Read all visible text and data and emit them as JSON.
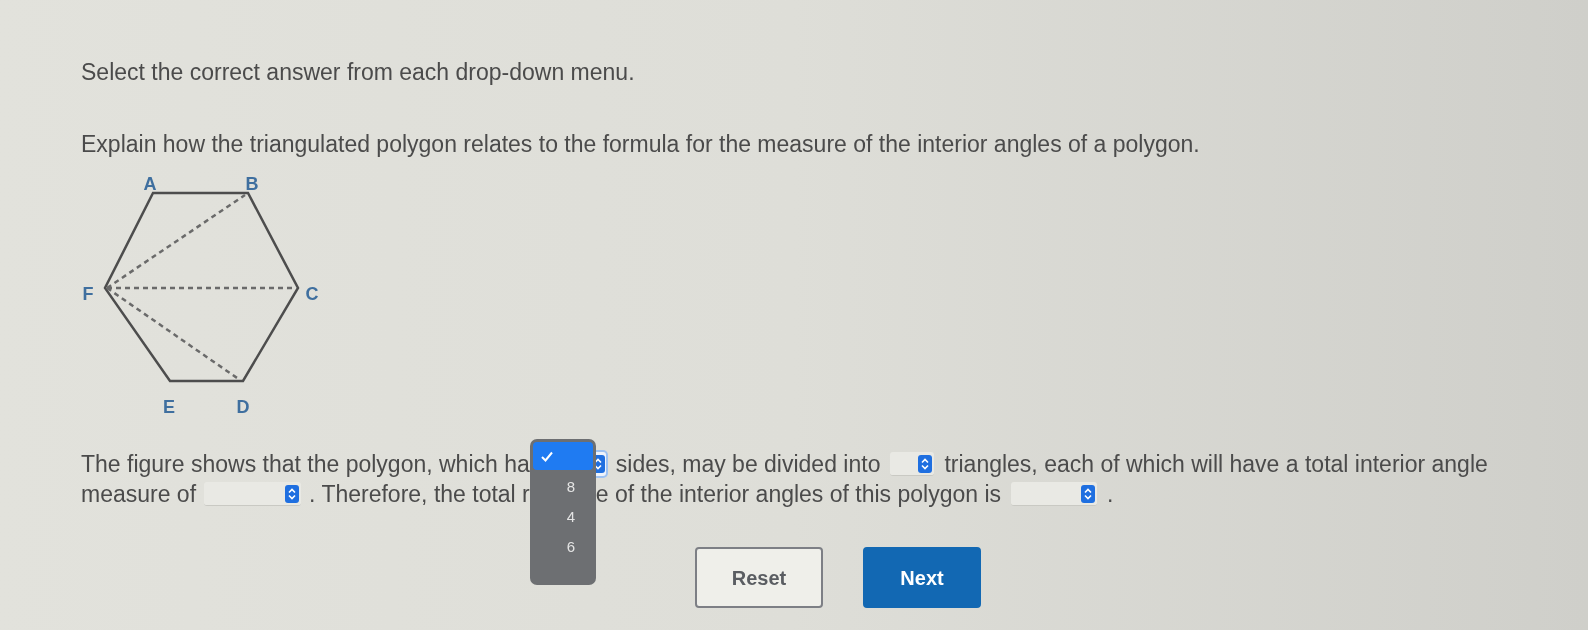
{
  "instructions": "Select the correct answer from each drop-down menu.",
  "question": "Explain how the triangulated polygon relates to the formula for the measure of the interior angles of a polygon.",
  "figure": {
    "vertex_labels": [
      "A",
      "B",
      "C",
      "D",
      "E",
      "F"
    ]
  },
  "paragraph": {
    "lines": [
      {
        "left": [
          {
            "kind": "text",
            "text": "The figure shows that the polygon, which ha"
          }
        ],
        "right": [
          {
            "kind": "dropdown",
            "open": true
          },
          {
            "kind": "text",
            "text": "sides, may be divided into"
          },
          {
            "kind": "dropdown",
            "open": false
          },
          {
            "kind": "text",
            "text": "triangles, each of which will have a total interior angle"
          }
        ]
      },
      {
        "left": [
          {
            "kind": "text",
            "text": "measure of"
          },
          {
            "kind": "dropdown",
            "open": false
          },
          {
            "kind": "text",
            "text": ". Therefore, the total r"
          }
        ],
        "right": [
          {
            "kind": "text",
            "text": "e of the interior angles of this polygon is"
          },
          {
            "kind": "dropdown",
            "open": false
          },
          {
            "kind": "text",
            "text": "."
          }
        ]
      }
    ],
    "menu": {
      "options": [
        {
          "selected": true
        },
        {
          "label": "8",
          "selected": false
        },
        {
          "label": "4",
          "selected": false
        },
        {
          "label": "6",
          "selected": false
        }
      ]
    }
  },
  "buttons": [
    {
      "label": "Reset",
      "kind": "secondary"
    },
    {
      "label": "Next",
      "kind": "primary"
    }
  ]
}
